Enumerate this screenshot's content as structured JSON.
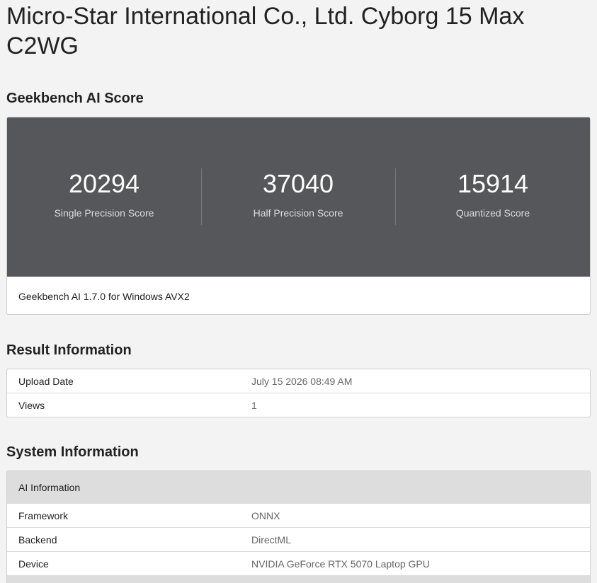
{
  "device": {
    "title": "Micro-Star International Co., Ltd. Cyborg 15 Max C2WG"
  },
  "score_section": {
    "title": "Geekbench AI Score",
    "scores": [
      {
        "value": "20294",
        "label": "Single Precision Score"
      },
      {
        "value": "37040",
        "label": "Half Precision Score"
      },
      {
        "value": "15914",
        "label": "Quantized Score"
      }
    ],
    "footer": "Geekbench AI 1.7.0 for Windows AVX2"
  },
  "result_section": {
    "title": "Result Information",
    "rows": [
      {
        "key": "Upload Date",
        "value": "July 15 2026 08:49 AM"
      },
      {
        "key": "Views",
        "value": "1"
      }
    ]
  },
  "system_section": {
    "title": "System Information",
    "group_title": "AI Information",
    "rows": [
      {
        "key": "Framework",
        "value": "ONNX"
      },
      {
        "key": "Backend",
        "value": "DirectML"
      },
      {
        "key": "Device",
        "value": "NVIDIA GeForce RTX 5070 Laptop GPU"
      }
    ]
  },
  "colors": {
    "page_background": "#f3f3f3",
    "score_band": "#56575b",
    "group_header": "#dddddd"
  }
}
